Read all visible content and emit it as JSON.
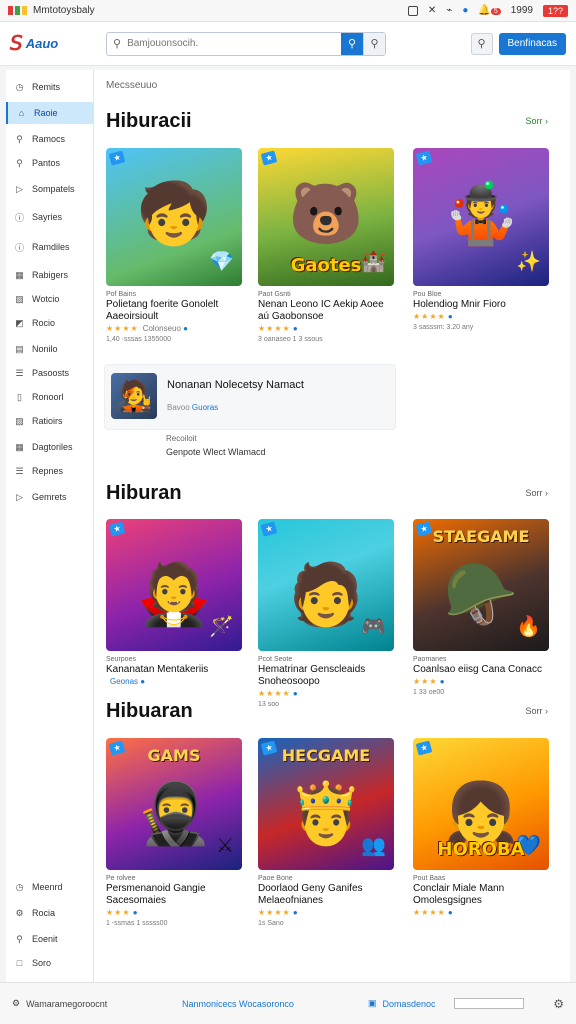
{
  "os_bar": {
    "app_title": "Mmtotoysbaly",
    "notification_count": "5",
    "clock": "1999",
    "tag": "1??",
    "colors": {
      "dot1": "#e53935",
      "dot2": "#43a047",
      "dot3": "#fbc02d"
    }
  },
  "header": {
    "logo_text": "Aauo",
    "search": {
      "placeholder": "Bamjouonsocih.",
      "value": ""
    },
    "primary_button": "Benfinacas"
  },
  "sidebar": {
    "items": [
      {
        "label": "Remits",
        "icon": "clock-icon"
      },
      {
        "label": "Raoie",
        "icon": "home-icon",
        "active": true
      },
      {
        "label": "Ramocs",
        "icon": "search-icon"
      },
      {
        "label": "Pantos",
        "icon": "search-icon"
      },
      {
        "label": "Sompatels",
        "icon": "play-icon"
      },
      {
        "label": "Sayries",
        "icon": "info-icon"
      },
      {
        "label": "Ramdiles",
        "icon": "info-icon"
      },
      {
        "label": "Rabigers",
        "icon": "grid-icon"
      },
      {
        "label": "Wotcio",
        "icon": "image-icon"
      },
      {
        "label": "Rocio",
        "icon": "chart-icon"
      },
      {
        "label": "Nonilo",
        "icon": "book-icon"
      },
      {
        "label": "Pasoosts",
        "icon": "list-icon"
      },
      {
        "label": "Ronoorl",
        "icon": "bookmark-icon"
      },
      {
        "label": "Ratioirs",
        "icon": "image-icon"
      },
      {
        "label": "Dagtoriles",
        "icon": "calendar-icon"
      },
      {
        "label": "Repnes",
        "icon": "list-icon"
      },
      {
        "label": "Gemrets",
        "icon": "play-icon"
      }
    ],
    "bottom_items": [
      {
        "label": "Meenrd",
        "icon": "clock-icon"
      },
      {
        "label": "Rocia",
        "icon": "settings-icon"
      },
      {
        "label": "Eoenit",
        "icon": "search-icon"
      },
      {
        "label": "Soro",
        "icon": "square-icon"
      }
    ]
  },
  "main": {
    "breadcrumb": "Mecsseuuo",
    "sections": [
      {
        "title": "Hiburacii",
        "see_all": "Sorr",
        "cards": [
          {
            "meta": "Pof Bains",
            "title": "Polietang foerite Gonolelt Aaeoirsioult",
            "rating_text": "Colonseuo",
            "stars": "★★★★",
            "stats": "1,40 ·sssas 1355000",
            "badge": "",
            "bg": "linear-gradient(160deg,#4fc3f7 0%,#66bb6a 70%,#2e7d32 100%)",
            "char": "🧒",
            "side": "💎"
          },
          {
            "meta": "Paot Gsnti",
            "title": "Nenan Leono IC Aekip Aoee aú Gaobonsoe",
            "rating_text": "",
            "stars": "★★★★",
            "stats": "3 oanaseo 1 3 ssous",
            "badge": "",
            "bg": "linear-gradient(170deg,#fdd835 0%,#7cb342 55%,#33691e 100%)",
            "char": "🐻",
            "side": "🏰",
            "cap": "Gaotes"
          },
          {
            "meta": "Pou Bloe",
            "title": "Holendiog Mnir Fioro",
            "rating_text": "",
            "stars": "★★★★",
            "stats": "3 sasssm: 3.20 any",
            "badge": "",
            "bg": "linear-gradient(160deg,#ab47bc 0%,#7e57c2 50%,#1a237e 100%)",
            "char": "🤹",
            "side": "✨"
          }
        ]
      },
      {
        "title": "Hiburan",
        "see_all": "Sorr",
        "cards": [
          {
            "meta": "Seurpoes",
            "title": "Kananatan Mentakeriis",
            "rating_text": "Geonas",
            "stars": "",
            "stats": "",
            "badge": "",
            "bg": "linear-gradient(160deg,#ec407a 0%,#8e24aa 55%,#311b92 100%)",
            "char": "🧛",
            "side": "🪄"
          },
          {
            "meta": "Pcot Seote",
            "title": "Hematrinar Genscleaids Snoheosoopo",
            "rating_text": "",
            "stars": "★★★★",
            "stats": "13 soo",
            "badge": "",
            "bg": "linear-gradient(160deg,#26c6da 0%,#4dd0e1 40%,#00838f 100%)",
            "char": "🧑",
            "side": "🎮"
          },
          {
            "meta": "Paomanes",
            "title": "Coanlsao eiisg Cana Conacc",
            "rating_text": "",
            "stars": "★★★",
            "stats": "1 33 oe00",
            "badge": "",
            "bg": "linear-gradient(160deg,#ef6c00 0%,#4e342e 55%,#1b1b1b 100%)",
            "char": "🪖",
            "side": "🔥",
            "top_cap": "STAEGAME"
          }
        ]
      },
      {
        "title": "Hibuaran",
        "see_all": "Sorr",
        "cards": [
          {
            "meta": "Pe rolvee",
            "title": "Persmenanoid Gangie Sacesomaies",
            "rating_text": "",
            "stars": "★★★",
            "stats": "1 -ssmas 1 sssss00",
            "badge": "",
            "bg": "linear-gradient(160deg,#ff7043 0%,#8e24aa 55%,#1a237e 100%)",
            "char": "🥷",
            "side": "⚔",
            "top_cap": "GAMS"
          },
          {
            "meta": "Paoe Bone",
            "title": "Doorlaod Geny Ganifes Melaeofnianes",
            "rating_text": "",
            "stars": "★★★★",
            "stats": "1s Sano",
            "badge": "",
            "bg": "linear-gradient(160deg,#1565c0 0%,#c62828 55%,#4a148c 100%)",
            "char": "🤴",
            "side": "👥",
            "top_cap": "HECGAME"
          },
          {
            "meta": "Pout Baas",
            "title": "Conclair Miale Mann Omolesgsignes",
            "rating_text": "",
            "stars": "★★★★",
            "stats": "",
            "badge": "",
            "bg": "linear-gradient(160deg,#fdd835 0%,#ff9800 55%,#e65100 100%)",
            "char": "👧",
            "side": "💙",
            "cap": "HOROBA"
          }
        ]
      }
    ],
    "featured": {
      "title": "Nonanan Nolecetsy Namact",
      "sub_prefix": "Bavoo",
      "sub_link": "Guoras",
      "note_label": "Recoiloit",
      "note_text": "Genpote Wlect Wlamacd"
    }
  },
  "footer": {
    "left": "Wamaramegoroocnt",
    "middle": "Nanmonicecs Wocasoronco",
    "right": "Domasdenoc"
  }
}
